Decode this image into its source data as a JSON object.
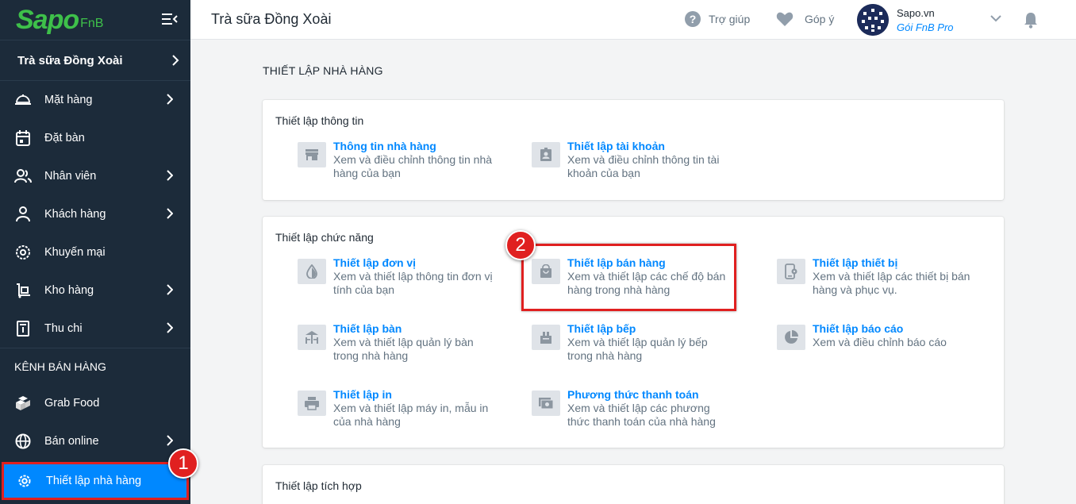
{
  "logo": {
    "main": "Sapo",
    "sub": "FnB"
  },
  "sidebar": {
    "store_name": "Trà sữa Đồng Xoài",
    "items": [
      {
        "label": "Mặt hàng",
        "icon": "tray-icon",
        "chevron": true
      },
      {
        "label": "Đặt bàn",
        "icon": "calendar-icon",
        "chevron": false
      },
      {
        "label": "Nhân viên",
        "icon": "users-icon",
        "chevron": true
      },
      {
        "label": "Khách hàng",
        "icon": "user-icon",
        "chevron": true
      },
      {
        "label": "Khuyến mại",
        "icon": "promo-icon",
        "chevron": false
      },
      {
        "label": "Kho hàng",
        "icon": "warehouse-icon",
        "chevron": true
      },
      {
        "label": "Thu chi",
        "icon": "receipt-icon",
        "chevron": true
      }
    ],
    "sales_channel_title": "KÊNH BÁN HÀNG",
    "channels": [
      {
        "label": "Grab Food",
        "icon": "boxes-icon",
        "chevron": false
      },
      {
        "label": "Bán online",
        "icon": "globe-icon",
        "chevron": true
      }
    ],
    "settings_label": "Thiết lập nhà hàng"
  },
  "topbar": {
    "title": "Trà sữa Đồng Xoài",
    "help_label": "Trợ giúp",
    "feedback_label": "Góp ý",
    "account_name": "Sapo.vn",
    "account_plan": "Gói FnB Pro"
  },
  "main": {
    "heading": "THIẾT LẬP NHÀ HÀNG",
    "info_card": {
      "title": "Thiết lập thông tin",
      "options": [
        {
          "title": "Thông tin nhà hàng",
          "desc": "Xem và điều chỉnh thông tin nhà hàng của bạn"
        },
        {
          "title": "Thiết lập tài khoản",
          "desc": "Xem và điều chỉnh thông tin tài khoản của bạn"
        }
      ]
    },
    "function_card": {
      "title": "Thiết lập chức năng",
      "options": [
        {
          "title": "Thiết lập đơn vị",
          "desc": "Xem và thiết lập thông tin đơn vị tính của bạn"
        },
        {
          "title": "Thiết lập bán hàng",
          "desc": "Xem và thiết lập các chế độ bán hàng trong nhà hàng"
        },
        {
          "title": "Thiết lập thiết bị",
          "desc": "Xem và thiết lập các thiết bị bán hàng và phục vụ."
        },
        {
          "title": "Thiết lập bàn",
          "desc": "Xem và thiết lập quản lý bàn trong nhà hàng"
        },
        {
          "title": "Thiết lập bếp",
          "desc": "Xem và thiết lập quản lý bếp trong nhà hàng"
        },
        {
          "title": "Thiết lập báo cáo",
          "desc": "Xem và điều chỉnh báo cáo"
        },
        {
          "title": "Thiết lập in",
          "desc": "Xem và thiết lập máy in, mẫu in của nhà hàng"
        },
        {
          "title": "Phương thức thanh toán",
          "desc": "Xem và thiết lập các phương thức thanh toán của nhà hàng"
        }
      ]
    },
    "integration_card": {
      "title": "Thiết lập tích hợp"
    }
  },
  "annotations": {
    "badge_1": "1",
    "badge_2": "2"
  },
  "colors": {
    "sidebar_bg": "#1c2b3a",
    "accent": "#0088ff",
    "brand_green": "#3ec04a",
    "highlight_red": "#e02020"
  }
}
